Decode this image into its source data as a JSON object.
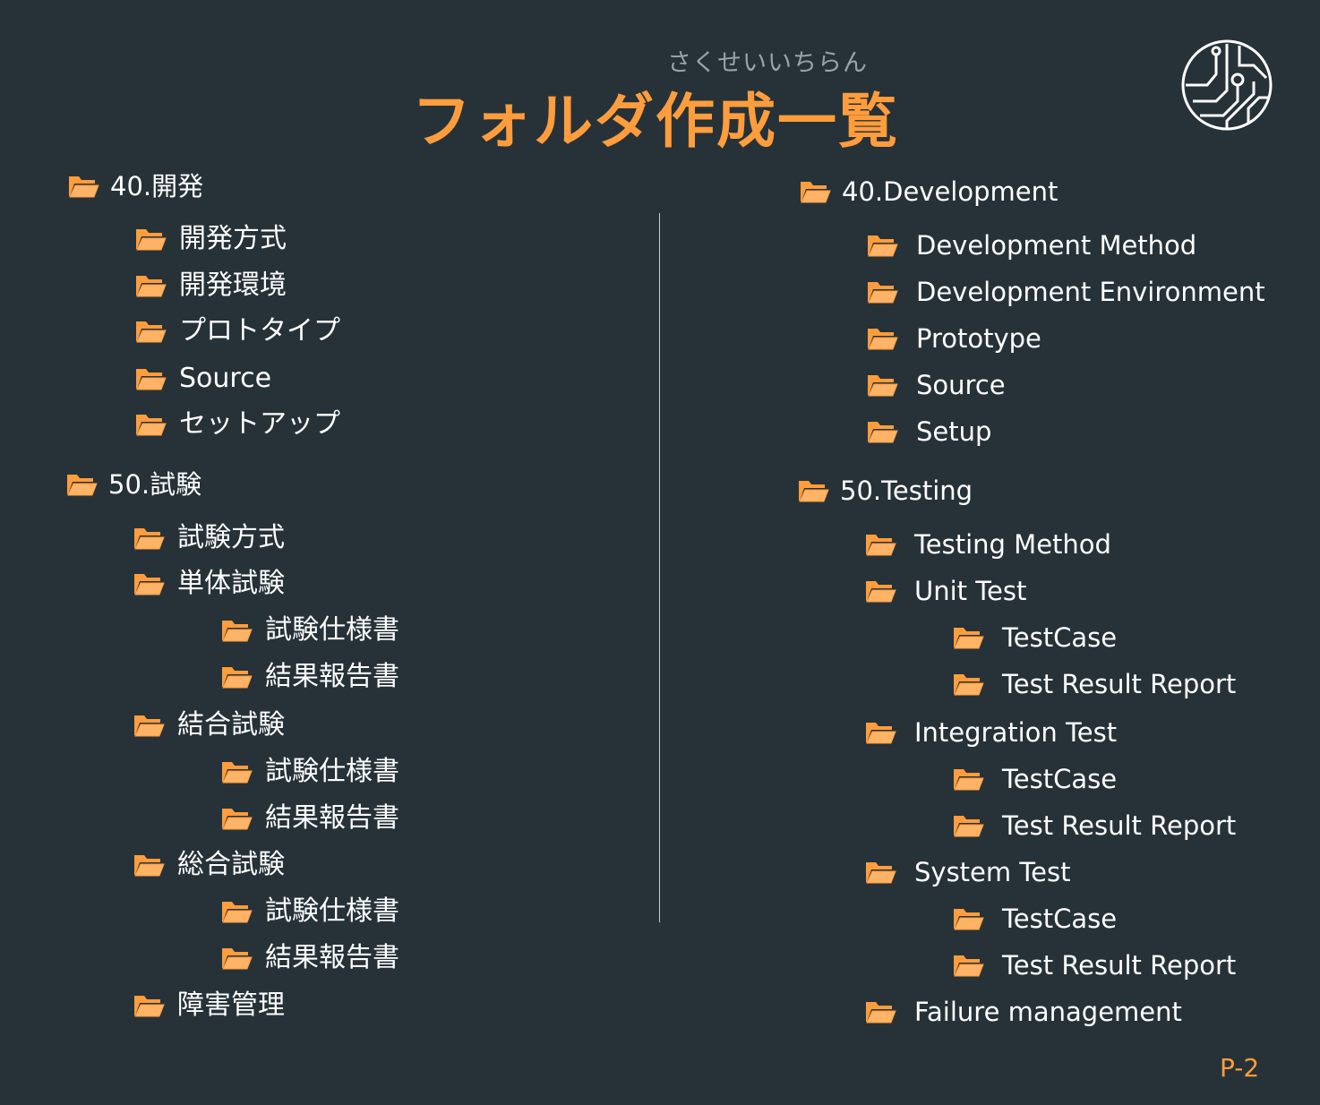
{
  "header": {
    "ruby": "さくせいいちらん",
    "title": "フォルダ作成一覧"
  },
  "colors": {
    "background": "#263238",
    "accent": "#ff9d3d",
    "text": "#ffffff"
  },
  "icons": {
    "folder": "folder-open-icon",
    "logo": "circuit-logo-icon"
  },
  "jp_tree": {
    "dev": {
      "label": "40.開発",
      "children": [
        "開発方式",
        "開発環境",
        "プロトタイプ",
        "Source",
        "セットアップ"
      ]
    },
    "test": {
      "label": "50.試験",
      "method": "試験方式",
      "unit": {
        "label": "単体試験",
        "children": [
          "試験仕様書",
          "結果報告書"
        ]
      },
      "integration": {
        "label": "結合試験",
        "children": [
          "試験仕様書",
          "結果報告書"
        ]
      },
      "system": {
        "label": "総合試験",
        "children": [
          "試験仕様書",
          "結果報告書"
        ]
      },
      "failure": "障害管理"
    }
  },
  "en_tree": {
    "dev": {
      "label": "40.Development",
      "children": [
        "Development Method",
        "Development Environment",
        "Prototype",
        "Source",
        "Setup"
      ]
    },
    "test": {
      "label": "50.Testing",
      "method": "Testing Method",
      "unit": {
        "label": "Unit Test",
        "children": [
          "TestCase",
          "Test Result Report"
        ]
      },
      "integration": {
        "label": "Integration Test",
        "children": [
          "TestCase",
          "Test Result Report"
        ]
      },
      "system": {
        "label": "System Test",
        "children": [
          "TestCase",
          "Test Result Report"
        ]
      },
      "failure": "Failure management"
    }
  },
  "footer": {
    "page": "P-2"
  }
}
